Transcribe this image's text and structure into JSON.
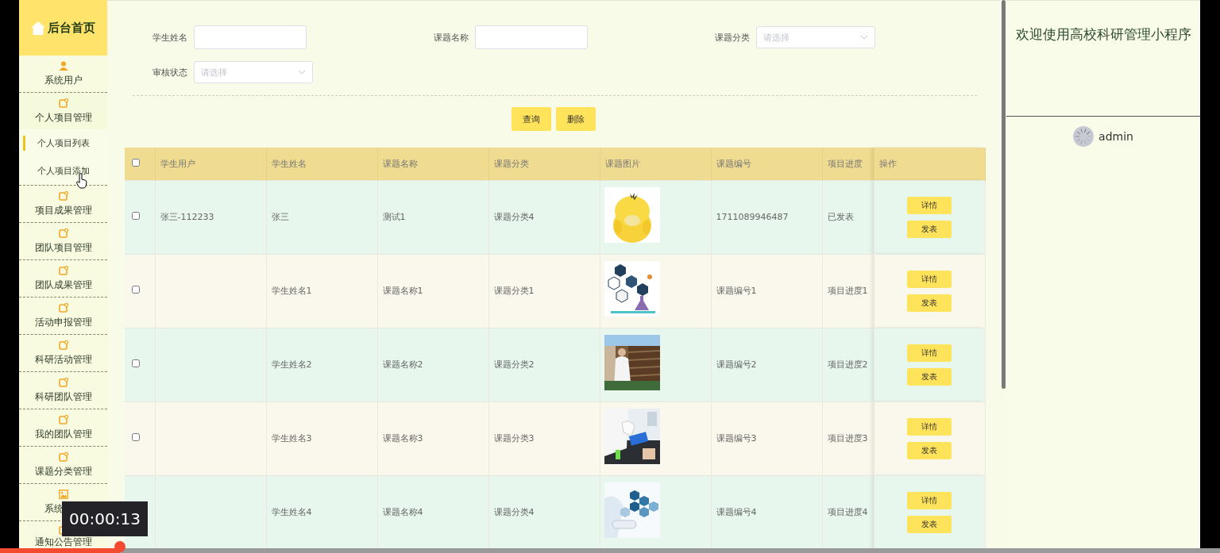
{
  "sidebar": {
    "home": "后台首页",
    "items": [
      {
        "label": "系统用户"
      },
      {
        "label": "个人项目管理",
        "expanded": true,
        "children": [
          {
            "label": "个人项目列表",
            "selected": true
          },
          {
            "label": "个人项目添加",
            "selected": false
          }
        ]
      },
      {
        "label": "项目成果管理"
      },
      {
        "label": "团队项目管理"
      },
      {
        "label": "团队成果管理"
      },
      {
        "label": "活动申报管理"
      },
      {
        "label": "科研活动管理"
      },
      {
        "label": "科研团队管理"
      },
      {
        "label": "我的团队管理"
      },
      {
        "label": "课题分类管理"
      },
      {
        "label": "系统"
      },
      {
        "label": "通知公告管理"
      }
    ]
  },
  "search": {
    "fields": [
      {
        "label": "学生姓名",
        "kind": "text"
      },
      {
        "label": "课题名称",
        "kind": "text"
      },
      {
        "label": "课题分类",
        "kind": "select",
        "placeholder": "请选择"
      },
      {
        "label": "审核状态",
        "kind": "select",
        "placeholder": "请选择"
      }
    ],
    "buttons": [
      "查询",
      "删除"
    ]
  },
  "table": {
    "select_all_checked": false,
    "columns": [
      "学生用户",
      "学生姓名",
      "课题名称",
      "课题分类",
      "课题图片",
      "课题编号",
      "项目进度",
      "操作"
    ],
    "rows": [
      {
        "checked": false,
        "student_user": "张三-112233",
        "student_name": "张三",
        "topic_name": "测试1",
        "topic_category": "课题分类4",
        "topic_number": "1711089946487",
        "progress": "已发表",
        "actions": [
          "详情",
          "发表"
        ]
      },
      {
        "checked": false,
        "student_name": "学生姓名1",
        "topic_name": "课题名称1",
        "topic_category": "课题分类1",
        "topic_number": "课题编号1",
        "progress": "项目进度1",
        "actions": [
          "详情",
          "发表"
        ]
      },
      {
        "checked": false,
        "student_name": "学生姓名2",
        "topic_name": "课题名称2",
        "topic_category": "课题分类2",
        "topic_number": "课题编号2",
        "progress": "项目进度2",
        "actions": [
          "详情",
          "发表"
        ]
      },
      {
        "checked": false,
        "student_name": "学生姓名3",
        "topic_name": "课题名称3",
        "topic_category": "课题分类3",
        "topic_number": "课题编号3",
        "progress": "项目进度3",
        "actions": [
          "详情",
          "发表"
        ]
      },
      {
        "student_name": "学生姓名4",
        "topic_name": "课题名称4",
        "topic_category": "课题分类4",
        "topic_number": "课题编号4",
        "progress": "项目进度4",
        "actions": [
          "详情",
          "发表"
        ]
      }
    ]
  },
  "panel": {
    "title": "欢迎使用高校科研管理小程序",
    "user": "admin"
  },
  "player": {
    "time": "00:00:13",
    "level": 0.098
  }
}
